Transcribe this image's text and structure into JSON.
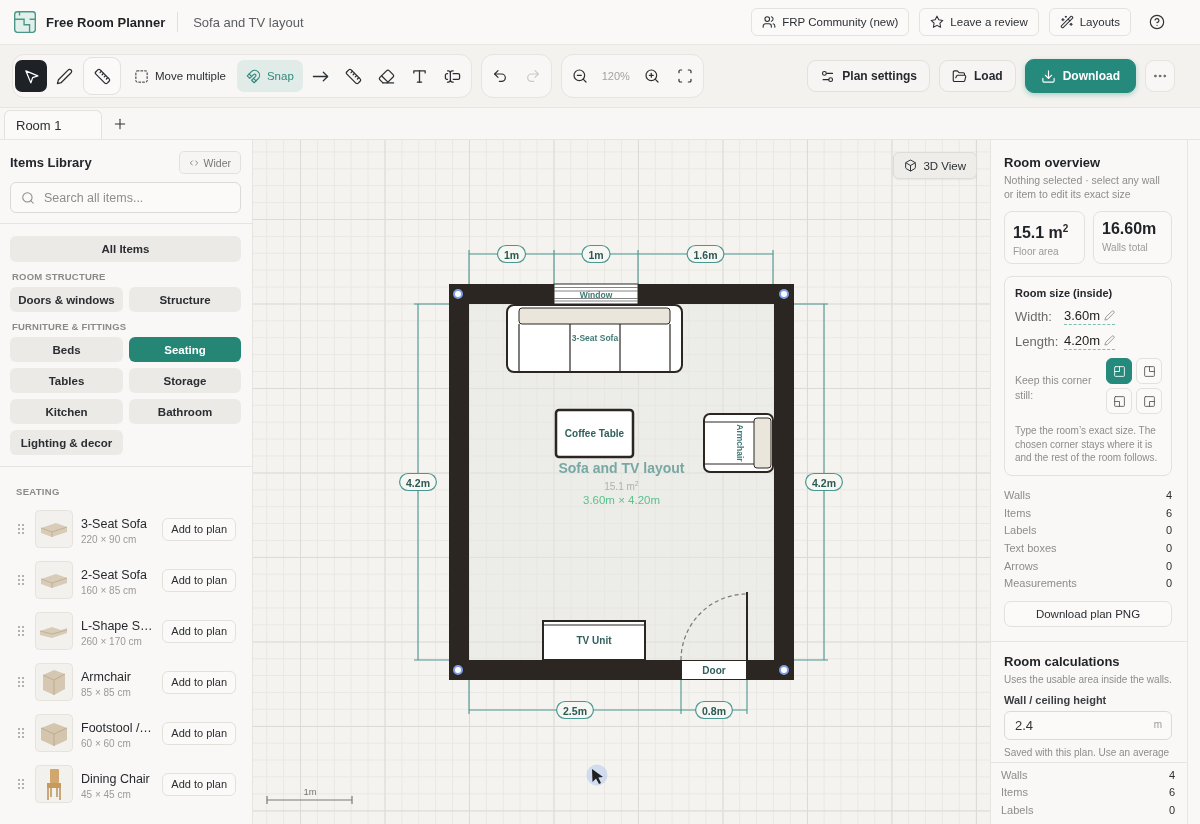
{
  "header": {
    "app_name": "Free Room Planner",
    "plan_title": "Sofa and TV layout",
    "links": [
      {
        "label": "FRP Community (new)"
      },
      {
        "label": "Leave a review"
      },
      {
        "label": "Layouts"
      }
    ]
  },
  "toolbar": {
    "tools": [
      {
        "kind": "icon",
        "selected": true
      },
      {
        "kind": "icon",
        "selected": false
      },
      {
        "kind": "framed",
        "selected": false
      },
      {
        "kind": "text",
        "label": "Move multiple",
        "selected": false
      },
      {
        "kind": "toggle",
        "label": "Snap",
        "on": true
      },
      {
        "kind": "icon",
        "selected": false
      },
      {
        "kind": "icon",
        "selected": false
      },
      {
        "kind": "icon",
        "selected": false
      },
      {
        "kind": "icon",
        "selected": false
      },
      {
        "kind": "icon",
        "selected": false
      }
    ],
    "history": [
      {
        "disabled": false
      },
      {
        "disabled": true
      }
    ],
    "zoom": {
      "reading": "120%"
    },
    "actions": [
      {
        "kind": "secondary",
        "label": "Plan settings"
      },
      {
        "kind": "secondary",
        "label": "Load"
      },
      {
        "kind": "primary",
        "label": "Download"
      }
    ]
  },
  "tabs": [
    {
      "label": "Room 1",
      "selected": true
    }
  ],
  "library": {
    "title": "Items Library",
    "wider_button": "Wider",
    "search": {
      "placeholder": "Search all items..."
    },
    "all_items": {
      "label": "All Items",
      "selected": false
    },
    "groups": [
      {
        "heading": "ROOM STRUCTURE",
        "categories": [
          {
            "label": "Doors & windows",
            "selected": false
          },
          {
            "label": "Structure",
            "selected": false
          }
        ]
      },
      {
        "heading": "FURNITURE & FITTINGS",
        "categories": [
          {
            "label": "Beds",
            "selected": false
          },
          {
            "label": "Seating",
            "selected": true
          },
          {
            "label": "Tables",
            "selected": false
          },
          {
            "label": "Storage",
            "selected": false
          },
          {
            "label": "Kitchen",
            "selected": false
          },
          {
            "label": "Bathroom",
            "selected": false
          },
          {
            "label": "Lighting & decor",
            "selected": false
          }
        ]
      }
    ],
    "section": "SEATING",
    "items": [
      {
        "kind": "sofa",
        "name": "3-Seat Sofa",
        "size": "220 × 90 cm",
        "button": "Add to plan"
      },
      {
        "kind": "sofa",
        "name": "2-Seat Sofa",
        "size": "160 × 85 cm",
        "button": "Add to plan"
      },
      {
        "kind": "l-sofa",
        "name": "L-Shape S…",
        "size": "260 × 170 cm",
        "button": "Add to plan"
      },
      {
        "kind": "armchair",
        "name": "Armchair",
        "size": "85 × 85 cm",
        "button": "Add to plan"
      },
      {
        "kind": "footstool",
        "name": "Footstool /…",
        "size": "60 × 60 cm",
        "button": "Add to plan"
      },
      {
        "kind": "chair",
        "name": "Dining Chair",
        "size": "45 × 45 cm",
        "button": "Add to plan"
      }
    ]
  },
  "canvas": {
    "view_button": "3D View",
    "openings": [
      {
        "kind": "window",
        "label": "Window"
      },
      {
        "kind": "door",
        "label": "Door"
      }
    ],
    "furniture": [
      {
        "kind": "sofa",
        "label": "3-Seat Sofa"
      },
      {
        "kind": "coffee-table",
        "label": "Coffee Table"
      },
      {
        "kind": "armchair",
        "label": "Armchair"
      },
      {
        "kind": "tv-unit",
        "label": "TV Unit"
      }
    ],
    "dimensions": {
      "top": [
        "1m",
        "1m",
        "1.6m"
      ],
      "left": "4.2m",
      "right": "4.2m",
      "bottom": [
        "2.5m",
        "0.8m"
      ]
    },
    "room_label": {
      "name": "Sofa and TV layout",
      "area": "15.1 m$^{2}$",
      "size": "3.60m × 4.20m"
    },
    "scale": "1m"
  },
  "overview": {
    "title": "Room overview",
    "subtitle": "Nothing selected · select any wall or item to edit its exact size",
    "stats": [
      {
        "value": "15.1 m$^{2}$",
        "label": "Floor area"
      },
      {
        "value": "16.60m",
        "label": "Walls total"
      }
    ],
    "room_size": {
      "title": "Room size (inside)",
      "fields": [
        {
          "label": "Width:",
          "value": "3.60m"
        },
        {
          "label": "Length:",
          "value": "4.20m"
        }
      ],
      "corner_label": "Keep this corner still:",
      "corners": [
        {
          "selected": true
        },
        {
          "selected": false
        },
        {
          "selected": false
        },
        {
          "selected": false
        }
      ],
      "hint": "Type the room’s exact size. The chosen corner stays where it is and the rest of the room follows."
    },
    "counts": [
      {
        "label": "Walls",
        "value": "4"
      },
      {
        "label": "Items",
        "value": "6"
      },
      {
        "label": "Labels",
        "value": "0"
      },
      {
        "label": "Text boxes",
        "value": "0"
      },
      {
        "label": "Arrows",
        "value": "0"
      },
      {
        "label": "Measurements",
        "value": "0"
      }
    ],
    "button": "Download plan PNG"
  },
  "calculations": {
    "title": "Room calculations",
    "subtitle": "Uses the usable area inside the walls.",
    "height_field": {
      "label": "Wall / ceiling height",
      "value": "2.4",
      "unit": "m"
    },
    "note": "Saved with this plan. Use an average"
  },
  "footer_counts": [
    {
      "label": "Walls",
      "value": "4"
    },
    {
      "label": "Items",
      "value": "6"
    },
    {
      "label": "Labels",
      "value": "0"
    }
  ]
}
